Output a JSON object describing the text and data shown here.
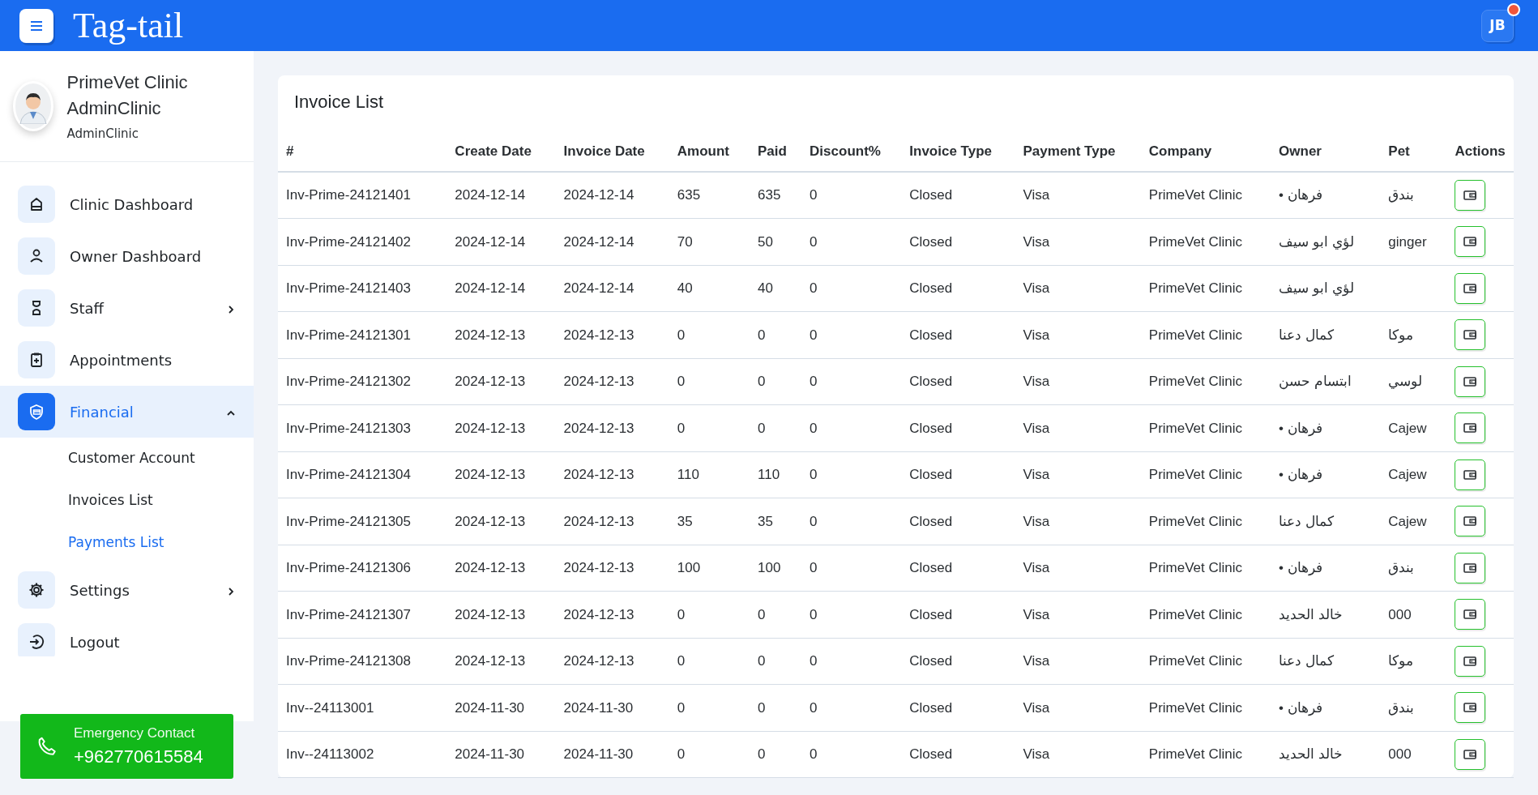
{
  "brand": "Tag-tail",
  "user": {
    "initials": "JB",
    "notification": true
  },
  "profile": {
    "name": "PrimeVet Clinic AdminClinic",
    "role": "AdminClinic"
  },
  "sidebar": {
    "items": [
      {
        "label": "Clinic Dashboard",
        "selected": false
      },
      {
        "label": "Owner Dashboard",
        "selected": false
      },
      {
        "label": "Staff",
        "selected": false,
        "expanded": false
      },
      {
        "label": "Appointments",
        "selected": false
      },
      {
        "label": "Financial",
        "selected": true,
        "expanded": true,
        "children": [
          {
            "label": "Customer Account",
            "selected": false
          },
          {
            "label": "Invoices List",
            "selected": false
          },
          {
            "label": "Payments List",
            "selected": true
          }
        ]
      },
      {
        "label": "Settings",
        "selected": false,
        "expanded": false
      },
      {
        "label": "Logout",
        "selected": false
      }
    ]
  },
  "emergency": {
    "label": "Emergency Contact",
    "phone": "+962770615584"
  },
  "table": {
    "title": "Invoice List",
    "columns": [
      "#",
      "Create Date",
      "Invoice Date",
      "Amount",
      "Paid",
      "Discount%",
      "Invoice Type",
      "Payment Type",
      "Company",
      "Owner",
      "Pet",
      "Actions"
    ],
    "rows": [
      [
        "Inv-Prime-24121401",
        "2024-12-14",
        "2024-12-14",
        "635",
        "635",
        "0",
        "Closed",
        "Visa",
        "PrimeVet Clinic",
        "• فرهان",
        "بندق"
      ],
      [
        "Inv-Prime-24121402",
        "2024-12-14",
        "2024-12-14",
        "70",
        "50",
        "0",
        "Closed",
        "Visa",
        "PrimeVet Clinic",
        "لؤي ابو سيف",
        "ginger"
      ],
      [
        "Inv-Prime-24121403",
        "2024-12-14",
        "2024-12-14",
        "40",
        "40",
        "0",
        "Closed",
        "Visa",
        "PrimeVet Clinic",
        "لؤي ابو سيف",
        ""
      ],
      [
        "Inv-Prime-24121301",
        "2024-12-13",
        "2024-12-13",
        "0",
        "0",
        "0",
        "Closed",
        "Visa",
        "PrimeVet Clinic",
        "كمال دعنا",
        "موكا"
      ],
      [
        "Inv-Prime-24121302",
        "2024-12-13",
        "2024-12-13",
        "0",
        "0",
        "0",
        "Closed",
        "Visa",
        "PrimeVet Clinic",
        "ابتسام حسن",
        "لوسي"
      ],
      [
        "Inv-Prime-24121303",
        "2024-12-13",
        "2024-12-13",
        "0",
        "0",
        "0",
        "Closed",
        "Visa",
        "PrimeVet Clinic",
        "• فرهان",
        "Cajew"
      ],
      [
        "Inv-Prime-24121304",
        "2024-12-13",
        "2024-12-13",
        "110",
        "110",
        "0",
        "Closed",
        "Visa",
        "PrimeVet Clinic",
        "• فرهان",
        "Cajew"
      ],
      [
        "Inv-Prime-24121305",
        "2024-12-13",
        "2024-12-13",
        "35",
        "35",
        "0",
        "Closed",
        "Visa",
        "PrimeVet Clinic",
        "كمال دعنا",
        "Cajew"
      ],
      [
        "Inv-Prime-24121306",
        "2024-12-13",
        "2024-12-13",
        "100",
        "100",
        "0",
        "Closed",
        "Visa",
        "PrimeVet Clinic",
        "• فرهان",
        "بندق"
      ],
      [
        "Inv-Prime-24121307",
        "2024-12-13",
        "2024-12-13",
        "0",
        "0",
        "0",
        "Closed",
        "Visa",
        "PrimeVet Clinic",
        "خالد الحديد",
        "000"
      ],
      [
        "Inv-Prime-24121308",
        "2024-12-13",
        "2024-12-13",
        "0",
        "0",
        "0",
        "Closed",
        "Visa",
        "PrimeVet Clinic",
        "كمال دعنا",
        "موكا"
      ],
      [
        "Inv--24113001",
        "2024-11-30",
        "2024-11-30",
        "0",
        "0",
        "0",
        "Closed",
        "Visa",
        "PrimeVet Clinic",
        "• فرهان",
        "بندق"
      ],
      [
        "Inv--24113002",
        "2024-11-30",
        "2024-11-30",
        "0",
        "0",
        "0",
        "Closed",
        "Visa",
        "PrimeVet Clinic",
        "خالد الحديد",
        "000"
      ]
    ]
  }
}
